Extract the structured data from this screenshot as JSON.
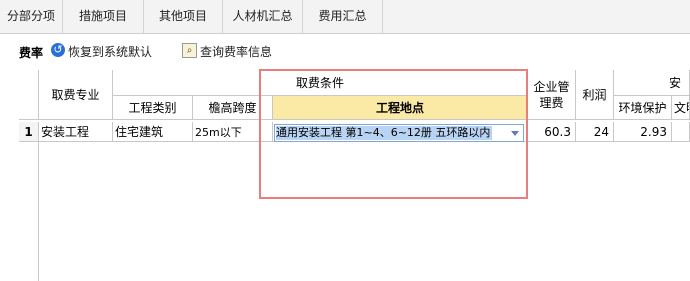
{
  "tabs": [
    "分部分项",
    "措施项目",
    "其他项目",
    "人材机汇总",
    "费用汇总"
  ],
  "toolbar": {
    "title": "费率",
    "restore_label": "恢复到系统默认",
    "query_label": "查询费率信息"
  },
  "table": {
    "headers": {
      "fee_specialty": "取费专业",
      "fee_conditions": "取费条件",
      "project_type": "工程类别",
      "eave_height": "檐高跨度",
      "project_location": "工程地点",
      "enterprise_mgmt": "企业管理费",
      "profit": "利润",
      "safety_group": "安",
      "env_protection": "环境保护",
      "civilized": "文明"
    },
    "rows": [
      {
        "index": "1",
        "fee_specialty": "安装工程",
        "project_type": "住宅建筑",
        "eave_height": "25m以下",
        "project_location": "通用安装工程 第1~4、6~12册 五环路以内",
        "enterprise_mgmt": "60.3",
        "profit": "24",
        "env_protection": "2.93",
        "civilized": ""
      }
    ]
  },
  "colors": {
    "highlight": "#fbe9a6",
    "annotation_box": "#e87d7d",
    "selection": "#b9d3f2"
  }
}
